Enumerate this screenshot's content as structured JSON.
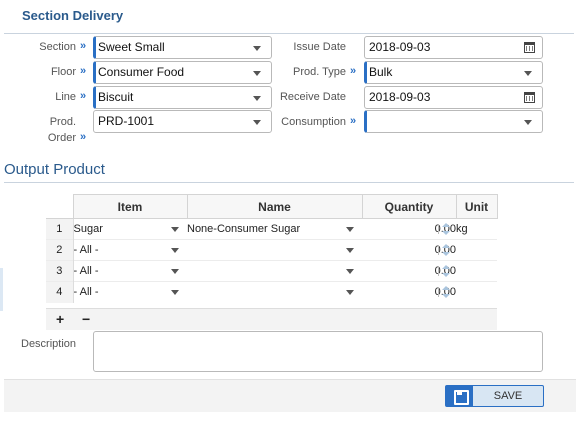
{
  "section_title": "Section Delivery",
  "form": {
    "section": {
      "label": "Section",
      "value": "Sweet Small"
    },
    "floor": {
      "label": "Floor",
      "value": "Consumer Food"
    },
    "line": {
      "label": "Line",
      "value": "Biscuit"
    },
    "prod_order": {
      "label_line1": "Prod.",
      "label_line2": "Order",
      "value": "PRD-1001"
    },
    "issue_date": {
      "label": "Issue Date",
      "value": "2018-09-03"
    },
    "prod_type": {
      "label": "Prod. Type",
      "value": "Bulk"
    },
    "receive_date": {
      "label": "Receive Date",
      "value": "2018-09-03"
    },
    "consumption": {
      "label": "Consumption",
      "value": ""
    },
    "chevron": "»"
  },
  "output": {
    "title": "Output Product",
    "columns": {
      "item": "Item",
      "name": "Name",
      "quantity": "Quantity",
      "unit": "Unit"
    },
    "rows": [
      {
        "num": "1",
        "item": "Sugar",
        "name": "None-Consumer Sugar",
        "quantity": "0.00",
        "unit": "kg"
      },
      {
        "num": "2",
        "item": "- All -",
        "name": "",
        "quantity": "0.00",
        "unit": ""
      },
      {
        "num": "3",
        "item": "- All -",
        "name": "",
        "quantity": "0.00",
        "unit": ""
      },
      {
        "num": "4",
        "item": "- All -",
        "name": "",
        "quantity": "0.00",
        "unit": ""
      }
    ],
    "add_label": "+",
    "remove_label": "−"
  },
  "description": {
    "label": "Description",
    "value": ""
  },
  "save_label": "SAVE",
  "icons": {
    "dropdown": "chevron-down-icon",
    "date": "calendar-icon",
    "spinner": "spinner-icon",
    "save": "save-icon"
  },
  "colors": {
    "accent": "#2a6fc4",
    "title": "#2a5a8c"
  }
}
